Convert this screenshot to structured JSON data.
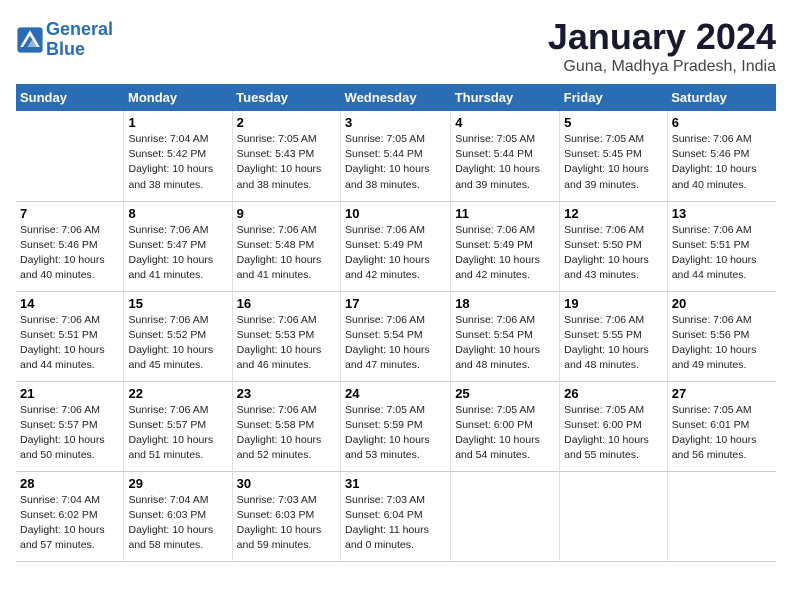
{
  "logo": {
    "line1": "General",
    "line2": "Blue"
  },
  "title": "January 2024",
  "location": "Guna, Madhya Pradesh, India",
  "days_header": [
    "Sunday",
    "Monday",
    "Tuesday",
    "Wednesday",
    "Thursday",
    "Friday",
    "Saturday"
  ],
  "weeks": [
    [
      {
        "num": "",
        "info": ""
      },
      {
        "num": "1",
        "info": "Sunrise: 7:04 AM\nSunset: 5:42 PM\nDaylight: 10 hours\nand 38 minutes."
      },
      {
        "num": "2",
        "info": "Sunrise: 7:05 AM\nSunset: 5:43 PM\nDaylight: 10 hours\nand 38 minutes."
      },
      {
        "num": "3",
        "info": "Sunrise: 7:05 AM\nSunset: 5:44 PM\nDaylight: 10 hours\nand 38 minutes."
      },
      {
        "num": "4",
        "info": "Sunrise: 7:05 AM\nSunset: 5:44 PM\nDaylight: 10 hours\nand 39 minutes."
      },
      {
        "num": "5",
        "info": "Sunrise: 7:05 AM\nSunset: 5:45 PM\nDaylight: 10 hours\nand 39 minutes."
      },
      {
        "num": "6",
        "info": "Sunrise: 7:06 AM\nSunset: 5:46 PM\nDaylight: 10 hours\nand 40 minutes."
      }
    ],
    [
      {
        "num": "7",
        "info": "Sunrise: 7:06 AM\nSunset: 5:46 PM\nDaylight: 10 hours\nand 40 minutes."
      },
      {
        "num": "8",
        "info": "Sunrise: 7:06 AM\nSunset: 5:47 PM\nDaylight: 10 hours\nand 41 minutes."
      },
      {
        "num": "9",
        "info": "Sunrise: 7:06 AM\nSunset: 5:48 PM\nDaylight: 10 hours\nand 41 minutes."
      },
      {
        "num": "10",
        "info": "Sunrise: 7:06 AM\nSunset: 5:49 PM\nDaylight: 10 hours\nand 42 minutes."
      },
      {
        "num": "11",
        "info": "Sunrise: 7:06 AM\nSunset: 5:49 PM\nDaylight: 10 hours\nand 42 minutes."
      },
      {
        "num": "12",
        "info": "Sunrise: 7:06 AM\nSunset: 5:50 PM\nDaylight: 10 hours\nand 43 minutes."
      },
      {
        "num": "13",
        "info": "Sunrise: 7:06 AM\nSunset: 5:51 PM\nDaylight: 10 hours\nand 44 minutes."
      }
    ],
    [
      {
        "num": "14",
        "info": "Sunrise: 7:06 AM\nSunset: 5:51 PM\nDaylight: 10 hours\nand 44 minutes."
      },
      {
        "num": "15",
        "info": "Sunrise: 7:06 AM\nSunset: 5:52 PM\nDaylight: 10 hours\nand 45 minutes."
      },
      {
        "num": "16",
        "info": "Sunrise: 7:06 AM\nSunset: 5:53 PM\nDaylight: 10 hours\nand 46 minutes."
      },
      {
        "num": "17",
        "info": "Sunrise: 7:06 AM\nSunset: 5:54 PM\nDaylight: 10 hours\nand 47 minutes."
      },
      {
        "num": "18",
        "info": "Sunrise: 7:06 AM\nSunset: 5:54 PM\nDaylight: 10 hours\nand 48 minutes."
      },
      {
        "num": "19",
        "info": "Sunrise: 7:06 AM\nSunset: 5:55 PM\nDaylight: 10 hours\nand 48 minutes."
      },
      {
        "num": "20",
        "info": "Sunrise: 7:06 AM\nSunset: 5:56 PM\nDaylight: 10 hours\nand 49 minutes."
      }
    ],
    [
      {
        "num": "21",
        "info": "Sunrise: 7:06 AM\nSunset: 5:57 PM\nDaylight: 10 hours\nand 50 minutes."
      },
      {
        "num": "22",
        "info": "Sunrise: 7:06 AM\nSunset: 5:57 PM\nDaylight: 10 hours\nand 51 minutes."
      },
      {
        "num": "23",
        "info": "Sunrise: 7:06 AM\nSunset: 5:58 PM\nDaylight: 10 hours\nand 52 minutes."
      },
      {
        "num": "24",
        "info": "Sunrise: 7:05 AM\nSunset: 5:59 PM\nDaylight: 10 hours\nand 53 minutes."
      },
      {
        "num": "25",
        "info": "Sunrise: 7:05 AM\nSunset: 6:00 PM\nDaylight: 10 hours\nand 54 minutes."
      },
      {
        "num": "26",
        "info": "Sunrise: 7:05 AM\nSunset: 6:00 PM\nDaylight: 10 hours\nand 55 minutes."
      },
      {
        "num": "27",
        "info": "Sunrise: 7:05 AM\nSunset: 6:01 PM\nDaylight: 10 hours\nand 56 minutes."
      }
    ],
    [
      {
        "num": "28",
        "info": "Sunrise: 7:04 AM\nSunset: 6:02 PM\nDaylight: 10 hours\nand 57 minutes."
      },
      {
        "num": "29",
        "info": "Sunrise: 7:04 AM\nSunset: 6:03 PM\nDaylight: 10 hours\nand 58 minutes."
      },
      {
        "num": "30",
        "info": "Sunrise: 7:03 AM\nSunset: 6:03 PM\nDaylight: 10 hours\nand 59 minutes."
      },
      {
        "num": "31",
        "info": "Sunrise: 7:03 AM\nSunset: 6:04 PM\nDaylight: 11 hours\nand 0 minutes."
      },
      {
        "num": "",
        "info": ""
      },
      {
        "num": "",
        "info": ""
      },
      {
        "num": "",
        "info": ""
      }
    ]
  ]
}
